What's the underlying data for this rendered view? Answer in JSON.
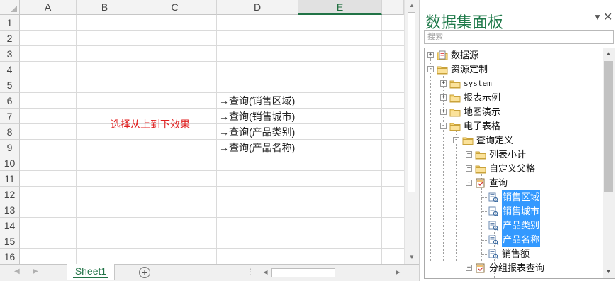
{
  "sheet": {
    "columns": [
      "A",
      "B",
      "C",
      "D",
      "E"
    ],
    "selected_column": "E",
    "rows": [
      "1",
      "2",
      "3",
      "4",
      "5",
      "6",
      "7",
      "8",
      "9",
      "10",
      "11",
      "12",
      "13",
      "14",
      "15",
      "16"
    ],
    "note_text": "选择从上到下效果",
    "note_color": "#e02020",
    "links": [
      "→查询(销售区域)",
      "→查询(销售城市)",
      "→查询(产品类别)",
      "→查询(产品名称)"
    ],
    "tab_name": "Sheet1"
  },
  "panel": {
    "title": "数据集面板",
    "dropdown_icon": "triangle-down-icon",
    "close_icon": "close-icon",
    "search_placeholder": "搜索",
    "tree": [
      {
        "label": "数据源",
        "icon": "datasource-icon",
        "toggle": "+"
      },
      {
        "label": "资源定制",
        "icon": "folder-icon",
        "toggle": "-"
      },
      {
        "label": "system",
        "icon": "folder-icon",
        "toggle": "+"
      },
      {
        "label": "报表示例",
        "icon": "folder-icon",
        "toggle": "+"
      },
      {
        "label": "地图演示",
        "icon": "folder-icon",
        "toggle": "+"
      },
      {
        "label": "电子表格",
        "icon": "folder-icon",
        "toggle": "-"
      },
      {
        "label": "查询定义",
        "icon": "folder-icon",
        "toggle": "-"
      },
      {
        "label": "列表小计",
        "icon": "folder-icon",
        "toggle": "+"
      },
      {
        "label": "自定义父格",
        "icon": "folder-icon",
        "toggle": "+"
      },
      {
        "label": "查询",
        "icon": "query-icon",
        "toggle": "-"
      },
      {
        "label": "销售区域",
        "icon": "field-icon",
        "selected": true
      },
      {
        "label": "销售城市",
        "icon": "field-icon",
        "selected": true
      },
      {
        "label": "产品类别",
        "icon": "field-icon",
        "selected": true
      },
      {
        "label": "产品名称",
        "icon": "field-icon",
        "selected": true
      },
      {
        "label": "销售额",
        "icon": "field-icon"
      },
      {
        "label": "分组报表查询",
        "icon": "query-icon",
        "toggle": "+"
      }
    ]
  },
  "colors": {
    "accent": "#217346",
    "selection": "#3399ff",
    "panel_title": "#1f7a4a"
  }
}
